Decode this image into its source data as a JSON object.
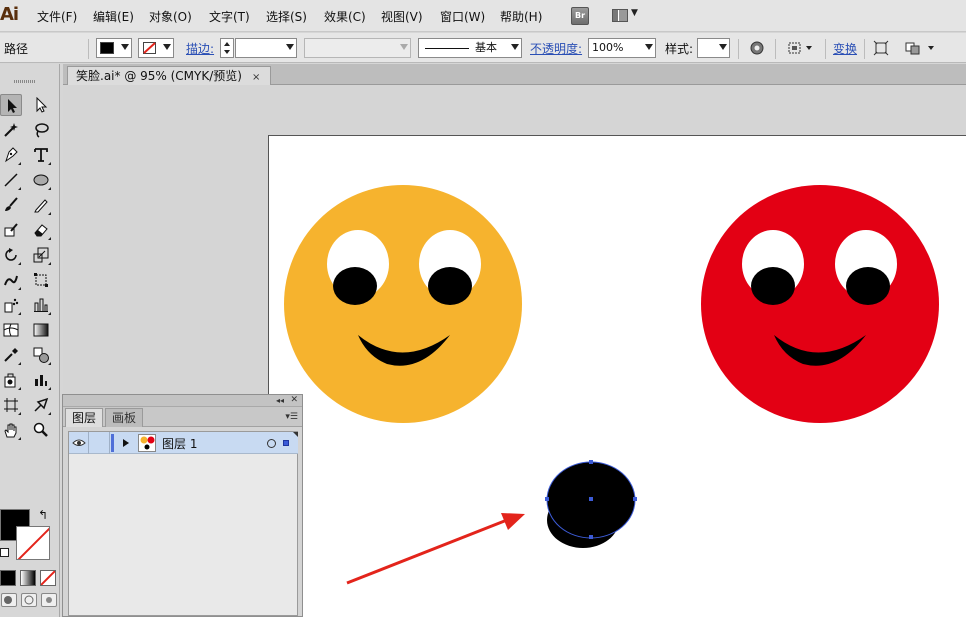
{
  "app": {
    "logo": "Ai"
  },
  "menu": [
    {
      "label": "文件(F)"
    },
    {
      "label": "编辑(E)"
    },
    {
      "label": "对象(O)"
    },
    {
      "label": "文字(T)"
    },
    {
      "label": "选择(S)"
    },
    {
      "label": "效果(C)"
    },
    {
      "label": "视图(V)"
    },
    {
      "label": "窗口(W)"
    },
    {
      "label": "帮助(H)"
    }
  ],
  "menubar_buttons": {
    "bridge": "Br",
    "workspace_icon": "workspace-switcher-icon"
  },
  "control_bar": {
    "mode_label": "路径",
    "stroke_label": "描边:",
    "stroke_style": "基本",
    "opacity_label": "不透明度:",
    "opacity_value": "100%",
    "style_label": "样式:",
    "transform_label": "变换",
    "fill_color": "#000000",
    "stroke_color": "none"
  },
  "document": {
    "tab_title": "笑脸.ai* @ 95% (CMYK/预览)",
    "close": "×"
  },
  "tools": [
    "selection-tool",
    "direct-selection-tool",
    "magic-wand-tool",
    "lasso-tool",
    "pen-tool",
    "type-tool",
    "line-segment-tool",
    "ellipse-tool",
    "paintbrush-tool",
    "pencil-tool",
    "blob-brush-tool",
    "eraser-tool",
    "rotate-tool",
    "scale-tool",
    "warp-tool",
    "free-transform-tool",
    "symbol-sprayer-tool",
    "column-graph-tool",
    "mesh-tool",
    "gradient-tool",
    "eyedropper-tool",
    "blend-tool",
    "symbol-tool",
    "graph-tool",
    "artboard-tool",
    "slice-tool",
    "hand-tool",
    "zoom-tool"
  ],
  "swatches": {
    "fill": "#000000",
    "stroke": "none",
    "stroke_slash": "#e3241b"
  },
  "layers_panel": {
    "tabs": [
      "图层",
      "画板"
    ],
    "layers": [
      {
        "name": "图层 1",
        "color": "#4f6fd8"
      }
    ]
  },
  "artwork": {
    "orange_face": "#f6b32e",
    "red_face": "#e30014",
    "eye_white": "#ffffff",
    "pupil": "#000000",
    "arrow": "#e3241b",
    "selection": "#3c5bd6"
  }
}
